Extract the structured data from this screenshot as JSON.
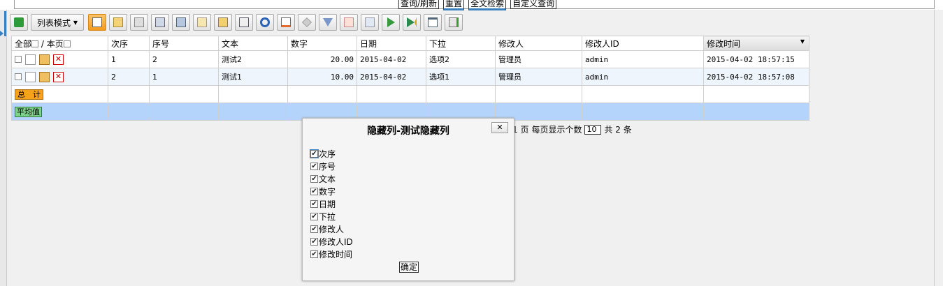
{
  "top_links": [
    "查询/刷新",
    "重置",
    "全文检索",
    "自定义查询"
  ],
  "toolbar": {
    "mode_label": "列表模式",
    "mode_caret": "▼",
    "icons": [
      "refresh-icon",
      "list-icon",
      "doc-icon",
      "copy-icon",
      "print-icon",
      "duplicate-icon",
      "edit-note-icon",
      "note-icon",
      "calc-icon",
      "reload-icon",
      "calendar-icon",
      "tools-icon",
      "filter-icon",
      "sheet-icon",
      "picture-icon",
      "play-icon",
      "next-icon",
      "window-icon",
      "export-icon"
    ]
  },
  "grid": {
    "header_all": "全部",
    "header_page": "/ 本页",
    "columns": [
      "次序",
      "序号",
      "文本",
      "数字",
      "日期",
      "下拉",
      "修改人",
      "修改人ID",
      "修改时间"
    ],
    "sort_caret": "▼",
    "rows": [
      [
        "1",
        "2",
        "测试2",
        "20.00",
        "2015-04-02",
        "选项2",
        "管理员",
        "admin",
        "2015-04-02 18:57:15"
      ],
      [
        "2",
        "1",
        "测试1",
        "10.00",
        "2015-04-02",
        "选项1",
        "管理员",
        "admin",
        "2015-04-02 18:57:08"
      ]
    ],
    "sum_label": "总　计",
    "avg_label": "平均值"
  },
  "pager": {
    "page_suffix": "1 页",
    "per_page_label": "每页显示个数",
    "page_size": "10",
    "total": "共 2 条"
  },
  "dialog": {
    "title": "隐藏列-测试隐藏列",
    "close": "✕",
    "items": [
      "次序",
      "序号",
      "文本",
      "数字",
      "日期",
      "下拉",
      "修改人",
      "修改人ID",
      "修改时间"
    ],
    "check_mark": "✔",
    "ok": "确定"
  },
  "colors": {
    "accent": "#3a7fc0",
    "highlight_button": "#f39a1d",
    "avg_row": "#b5d4fb",
    "alt_row": "#eef5fd"
  }
}
